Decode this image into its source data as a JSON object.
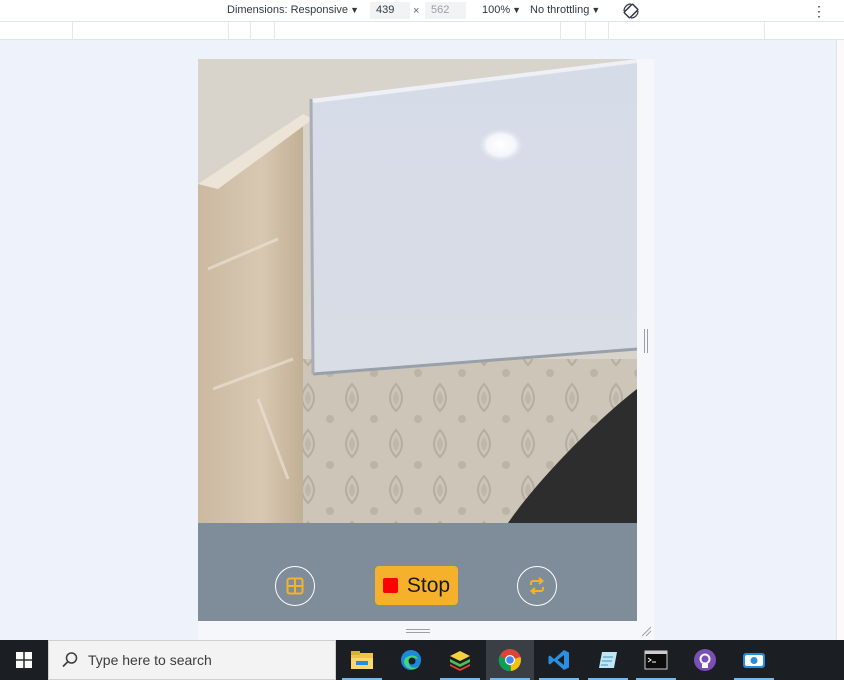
{
  "devtools": {
    "dimensions_label": "Dimensions: Responsive",
    "width": "439",
    "times": "×",
    "height": "562",
    "zoom": "100%",
    "throttling": "No throttling",
    "more": "⋮"
  },
  "camera_app": {
    "stop_label": "Stop",
    "accent_color": "#f6b12c",
    "controls_background": "#7f8c99",
    "left_button_icon": "grid-icon",
    "right_button_icon": "switch-camera-icon"
  },
  "taskbar": {
    "search_placeholder": "Type here to search",
    "apps": [
      "file-explorer",
      "edge",
      "bluestacks",
      "chrome",
      "vscode",
      "editor",
      "terminal",
      "github-desktop",
      "camera"
    ],
    "active_app": "chrome"
  }
}
